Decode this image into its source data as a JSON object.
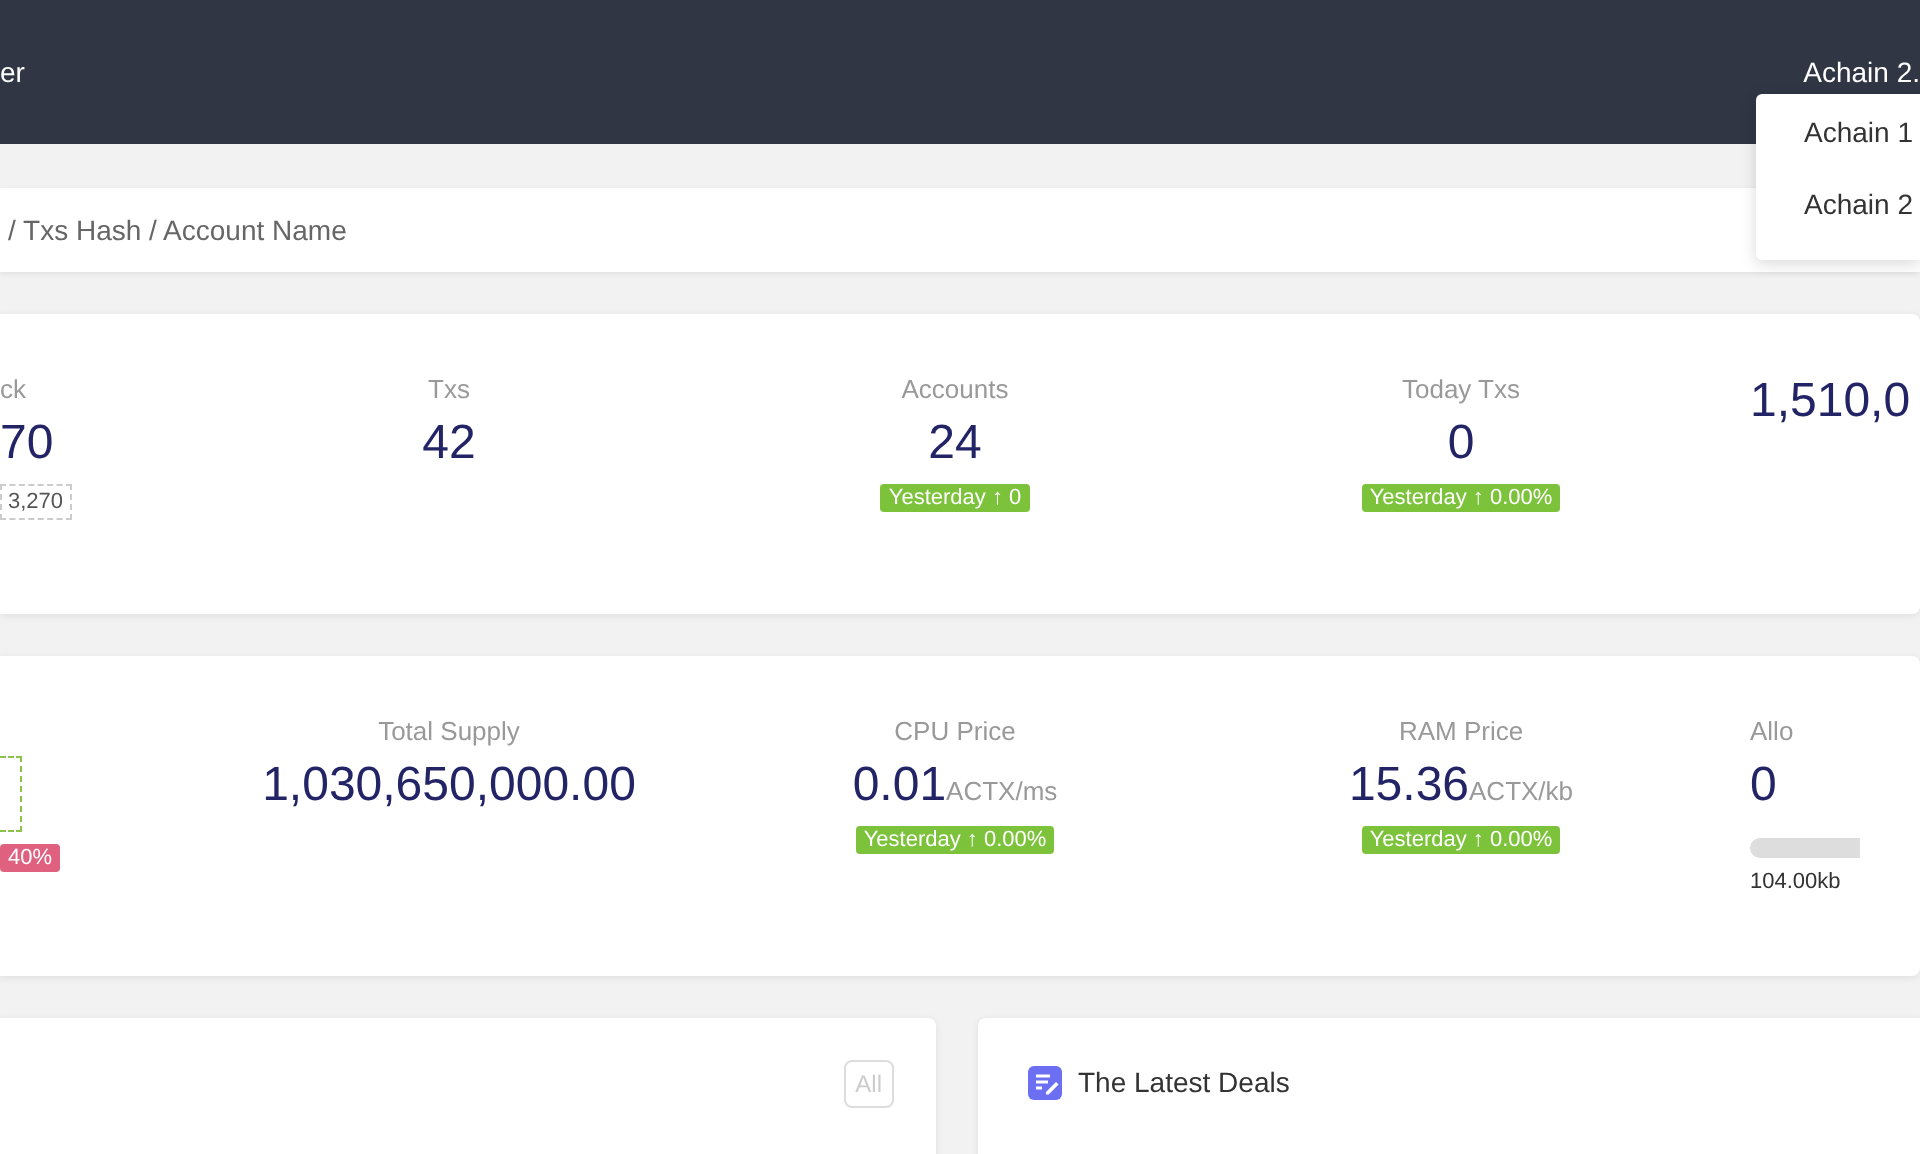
{
  "header": {
    "title": "er",
    "network": "Achain 2.",
    "menu": [
      {
        "label": "Achain 1"
      },
      {
        "label": "Achain 2"
      }
    ]
  },
  "search": {
    "placeholder": "/ Txs Hash / Account Name"
  },
  "stats_rows": [
    {
      "columns": [
        {
          "label": "ck",
          "value": "70",
          "sub": "3,270"
        },
        {
          "label": "Txs",
          "value": "42"
        },
        {
          "label": "Accounts",
          "value": "24",
          "badge": {
            "text": "Yesterday ↑ 0",
            "kind": "up"
          }
        },
        {
          "label": "Today Txs",
          "value": "0",
          "badge": {
            "text": "Yesterday ↑ 0.00%",
            "kind": "up"
          }
        },
        {
          "value": "1,510,0"
        }
      ]
    },
    {
      "columns": [
        {
          "frame": true,
          "badge": {
            "text": "40%",
            "kind": "down"
          }
        },
        {
          "label": "Total Supply",
          "value": "1,030,650,000.00"
        },
        {
          "label": "CPU Price",
          "value": "0.01",
          "unit": "ACTX/ms",
          "badge": {
            "text": "Yesterday ↑ 0.00%",
            "kind": "up"
          }
        },
        {
          "label": "RAM Price",
          "value": "15.36",
          "unit": "ACTX/kb",
          "badge": {
            "text": "Yesterday ↑ 0.00%",
            "kind": "up"
          }
        },
        {
          "label": "Allo",
          "value": "0",
          "progress": {
            "level": 0,
            "reading": "104.00kb"
          }
        }
      ]
    }
  ],
  "panels": [
    {
      "button": "All"
    },
    {
      "title": "The Latest Deals"
    }
  ]
}
